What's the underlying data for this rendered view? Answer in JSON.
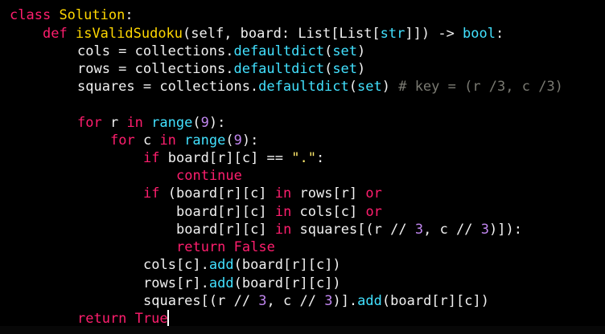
{
  "code": {
    "l1": {
      "t0": "class",
      "t1": " ",
      "t2": "Solution",
      "t3": ":"
    },
    "l2": {
      "t0": "def",
      "t1": " ",
      "t2": "isValidSudoku",
      "t3": "(self, board: List[List[",
      "t4": "str",
      "t5": "]]) -> ",
      "t6": "bool",
      "t7": ":"
    },
    "l3": {
      "t0": "cols = collections.",
      "t1": "defaultdict",
      "t2": "(",
      "t3": "set",
      "t4": ")"
    },
    "l4": {
      "t0": "rows = collections.",
      "t1": "defaultdict",
      "t2": "(",
      "t3": "set",
      "t4": ")"
    },
    "l5": {
      "t0": "squares = collections.",
      "t1": "defaultdict",
      "t2": "(",
      "t3": "set",
      "t4": ") ",
      "t5": "# key = (r /3, c /3)"
    },
    "l6": {
      "t0": "for",
      "t1": " r ",
      "t2": "in",
      "t3": " ",
      "t4": "range",
      "t5": "(",
      "t6": "9",
      "t7": "):"
    },
    "l7": {
      "t0": "for",
      "t1": " c ",
      "t2": "in",
      "t3": " ",
      "t4": "range",
      "t5": "(",
      "t6": "9",
      "t7": "):"
    },
    "l8": {
      "t0": "if",
      "t1": " board[r][c] == ",
      "t2": "\".\"",
      "t3": ":"
    },
    "l9": {
      "t0": "continue"
    },
    "l10": {
      "t0": "if",
      "t1": " (board[r][c] ",
      "t2": "in",
      "t3": " rows[r] ",
      "t4": "or"
    },
    "l11": {
      "t0": "board[r][c] ",
      "t1": "in",
      "t2": " cols[c] ",
      "t3": "or"
    },
    "l12": {
      "t0": "board[r][c] ",
      "t1": "in",
      "t2": " squares[(r // ",
      "t3": "3",
      "t4": ", c // ",
      "t5": "3",
      "t6": ")]):"
    },
    "l13": {
      "t0": "return",
      "t1": " ",
      "t2": "False"
    },
    "l14": {
      "t0": "cols[c].",
      "t1": "add",
      "t2": "(board[r][c])"
    },
    "l15": {
      "t0": "rows[r].",
      "t1": "add",
      "t2": "(board[r][c])"
    },
    "l16": {
      "t0": "squares[(r // ",
      "t1": "3",
      "t2": ", c // ",
      "t3": "3",
      "t4": ")].",
      "t5": "add",
      "t6": "(board[r][c])"
    },
    "l17": {
      "t0": "return",
      "t1": " ",
      "t2": "True"
    }
  },
  "colors": {
    "background": "#000000",
    "keyword": "#ff1e6e",
    "function_name": "#ffd700",
    "builtin": "#42e1ff",
    "number": "#c186f0",
    "string": "#ffe86b",
    "comment": "#7a7a72",
    "text": "#f1f1f1"
  }
}
